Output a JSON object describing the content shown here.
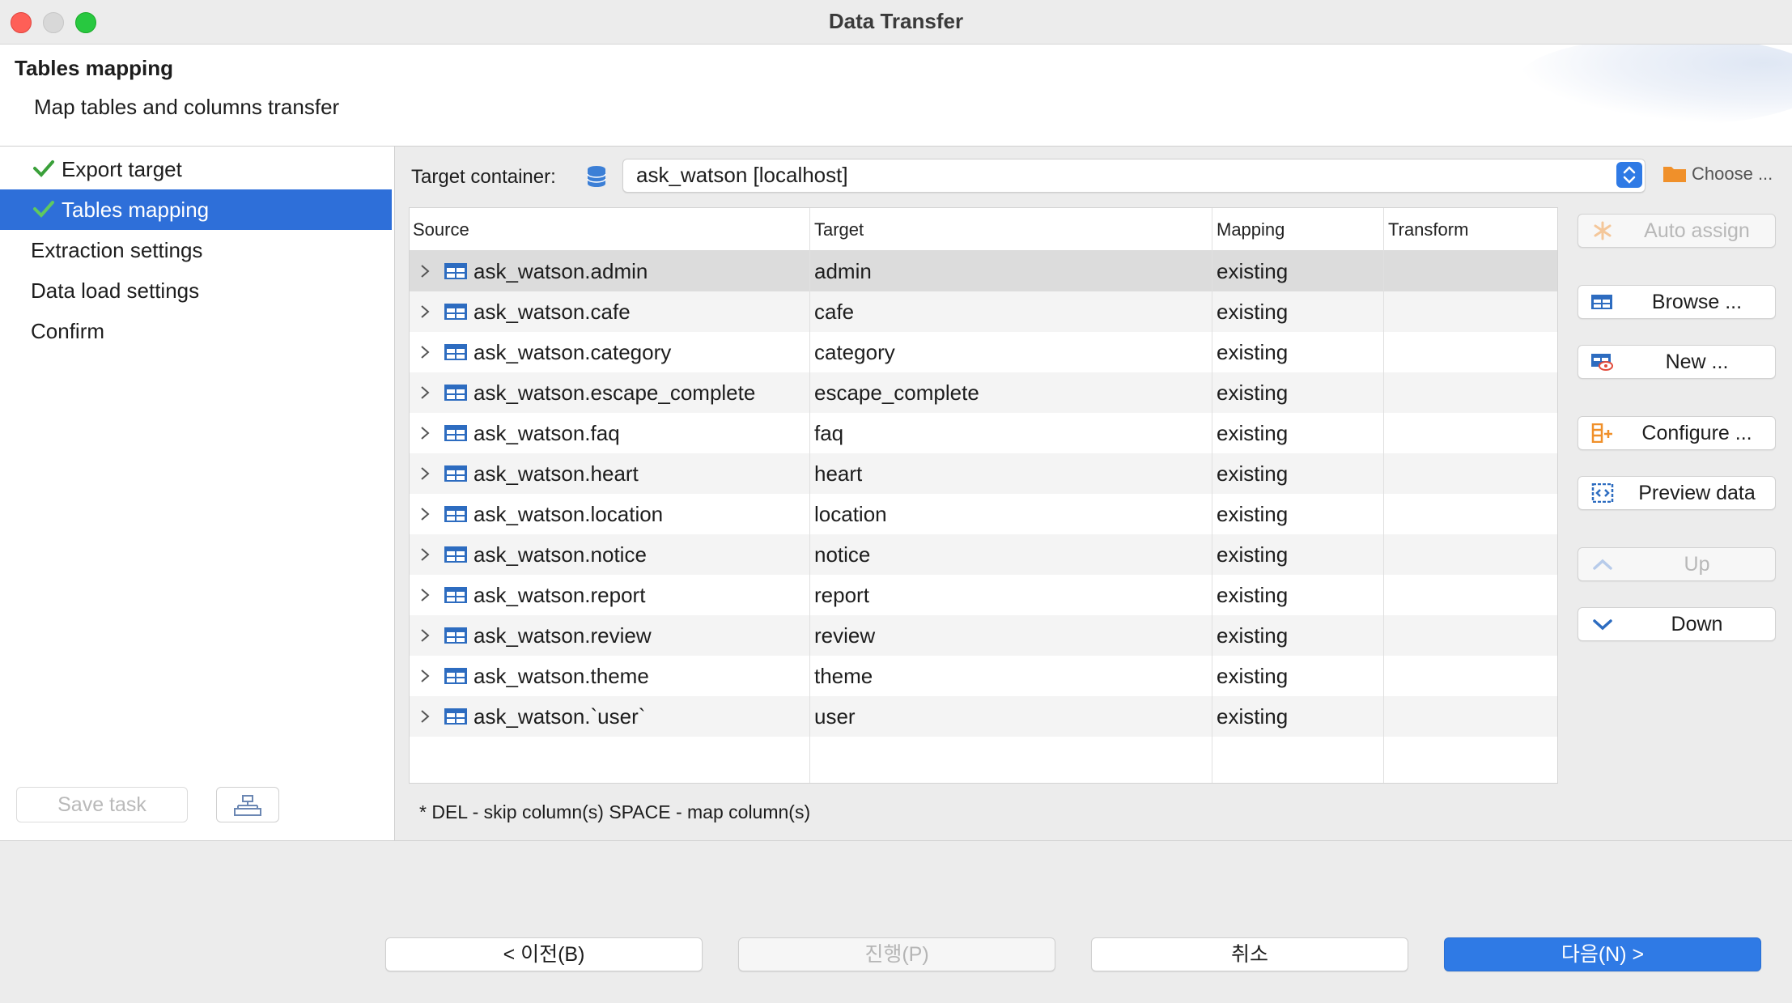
{
  "window": {
    "title": "Data Transfer"
  },
  "header": {
    "title": "Tables mapping",
    "description": "Map tables and columns transfer"
  },
  "nav": {
    "items": [
      {
        "label": "Export target",
        "checked": true
      },
      {
        "label": "Tables mapping",
        "checked": true,
        "selected": true
      },
      {
        "label": "Extraction settings"
      },
      {
        "label": "Data load settings"
      },
      {
        "label": "Confirm"
      }
    ],
    "save_task": "Save task"
  },
  "target": {
    "label": "Target container:",
    "value": "ask_watson  [localhost]",
    "choose": "Choose ..."
  },
  "table": {
    "columns": [
      "Source",
      "Target",
      "Mapping",
      "Transform"
    ],
    "rows": [
      {
        "source": "ask_watson.admin",
        "target": "admin",
        "mapping": "existing"
      },
      {
        "source": "ask_watson.cafe",
        "target": "cafe",
        "mapping": "existing"
      },
      {
        "source": "ask_watson.category",
        "target": "category",
        "mapping": "existing"
      },
      {
        "source": "ask_watson.escape_complete",
        "target": "escape_complete",
        "mapping": "existing"
      },
      {
        "source": "ask_watson.faq",
        "target": "faq",
        "mapping": "existing"
      },
      {
        "source": "ask_watson.heart",
        "target": "heart",
        "mapping": "existing"
      },
      {
        "source": "ask_watson.location",
        "target": "location",
        "mapping": "existing"
      },
      {
        "source": "ask_watson.notice",
        "target": "notice",
        "mapping": "existing"
      },
      {
        "source": "ask_watson.report",
        "target": "report",
        "mapping": "existing"
      },
      {
        "source": "ask_watson.review",
        "target": "review",
        "mapping": "existing"
      },
      {
        "source": "ask_watson.theme",
        "target": "theme",
        "mapping": "existing"
      },
      {
        "source": "ask_watson.`user`",
        "target": "user",
        "mapping": "existing"
      }
    ]
  },
  "hint": "* DEL - skip column(s)  SPACE - map column(s)",
  "side_buttons": {
    "auto_assign": "Auto assign",
    "browse": "Browse ...",
    "new": "New ...",
    "configure": "Configure ...",
    "preview": "Preview data",
    "up": "Up",
    "down": "Down"
  },
  "footer": {
    "back": "< 이전(B)",
    "proceed": "진행(P)",
    "cancel": "취소",
    "next": "다음(N) >"
  },
  "colors": {
    "accent": "#2e6fd9",
    "check": "#3aa03a",
    "table_icon": "#2d6cc0"
  }
}
